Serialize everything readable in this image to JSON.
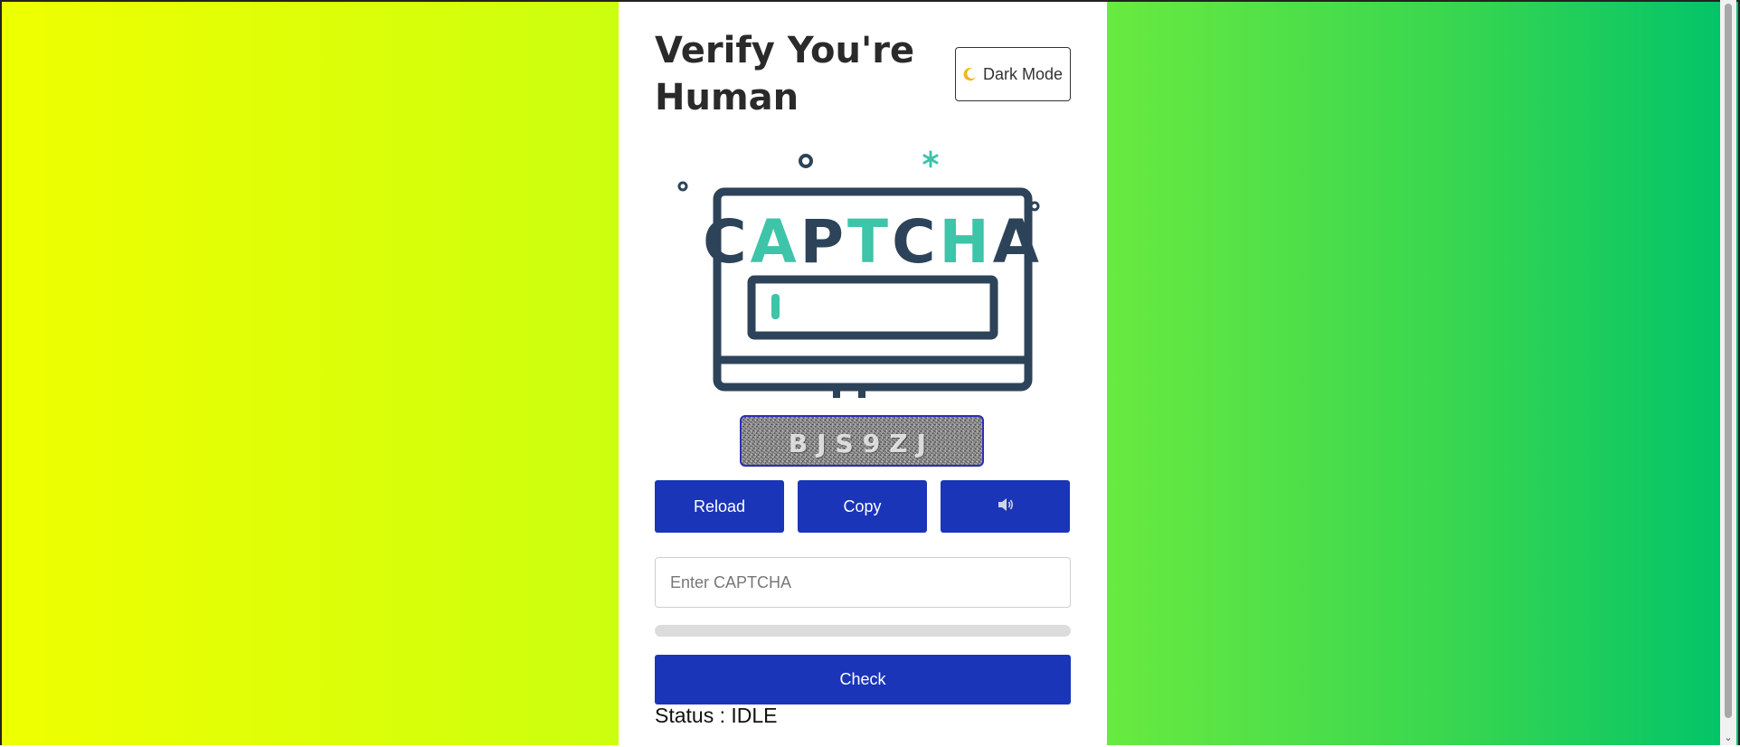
{
  "header": {
    "title": "Verify You're Human",
    "dark_mode_label": "Dark Mode",
    "dark_mode_icon": "moon-icon"
  },
  "illustration": {
    "word": "CAPTCHA",
    "colors": {
      "dark": "#2d4359",
      "accent": "#3ec4a8"
    }
  },
  "captcha": {
    "code": "BJS9ZJ"
  },
  "actions": {
    "reload_label": "Reload",
    "copy_label": "Copy",
    "audio_icon": "speaker-icon"
  },
  "form": {
    "input_placeholder": "Enter CAPTCHA",
    "input_value": "",
    "progress": 0,
    "check_label": "Check"
  },
  "status": {
    "text": "Status : IDLE"
  },
  "theme": {
    "primary": "#1a35b8",
    "background_gradient": [
      "#efff00",
      "#00c36a"
    ]
  }
}
